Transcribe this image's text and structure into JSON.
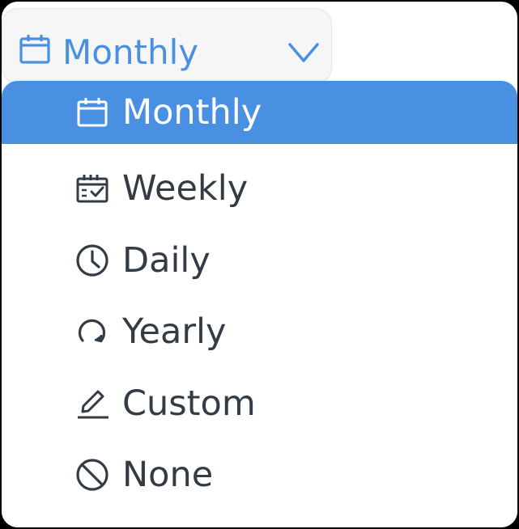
{
  "dropdown": {
    "selected_label": "Monthly",
    "accent_color": "#4a90e2",
    "icon": "calendar-icon",
    "toggle_icon": "chevron-down-icon"
  },
  "menu": {
    "items": [
      {
        "label": "Monthly",
        "icon": "calendar-icon",
        "selected": true
      },
      {
        "label": "Weekly",
        "icon": "calendar-check-icon",
        "selected": false
      },
      {
        "label": "Daily",
        "icon": "clock-icon",
        "selected": false
      },
      {
        "label": "Yearly",
        "icon": "refresh-icon",
        "selected": false
      },
      {
        "label": "Custom",
        "icon": "pencil-icon",
        "selected": false
      },
      {
        "label": "None",
        "icon": "ban-icon",
        "selected": false
      }
    ]
  }
}
